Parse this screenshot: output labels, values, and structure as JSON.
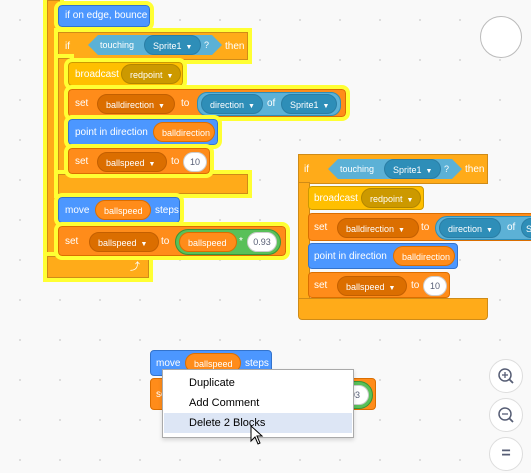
{
  "script1": {
    "hat_label": "if on edge, bounce",
    "if_label": "if",
    "then_label": "then",
    "touching_label": "touching",
    "touching_target": "Sprite1",
    "question": "?",
    "broadcast_label": "broadcast",
    "broadcast_msg": "redpoint",
    "set1_label": "set",
    "set1_var": "balldirection",
    "to_label": "to",
    "direction_label": "direction",
    "of_label": "of",
    "of_target": "Sprite1",
    "point_label": "point in direction",
    "point_value": "balldirection",
    "set2_label": "set",
    "set2_var": "ballspeed",
    "set2_value": "10",
    "move_label": "move",
    "move_value": "ballspeed",
    "steps_label": "steps",
    "set3_label": "set",
    "set3_var": "ballspeed",
    "op_left": "ballspeed",
    "op_symbol": "*",
    "op_right": "0.93"
  },
  "script2": {
    "if_label": "if",
    "then_label": "then",
    "touching_label": "touching",
    "touching_target": "Sprite1",
    "question": "?",
    "broadcast_label": "broadcast",
    "broadcast_msg": "redpoint",
    "set1_label": "set",
    "set1_var": "balldirection",
    "to_label": "to",
    "direction_label": "direction",
    "of_label": "of",
    "of_partial": "S",
    "point_label": "point in direction",
    "point_value": "balldirection",
    "set2_label": "set",
    "set2_var": "ballspeed",
    "set2_value": "10"
  },
  "script3": {
    "move_label": "move",
    "move_value": "ballspeed",
    "steps_label": "steps",
    "set_partial": "se",
    "value_partial": "93"
  },
  "context_menu": {
    "items": [
      "Duplicate",
      "Add Comment",
      "Delete 2 Blocks"
    ]
  },
  "zoom": {
    "in_icon": "zoom-in-icon",
    "out_icon": "zoom-out-icon",
    "reset_symbol": "="
  }
}
